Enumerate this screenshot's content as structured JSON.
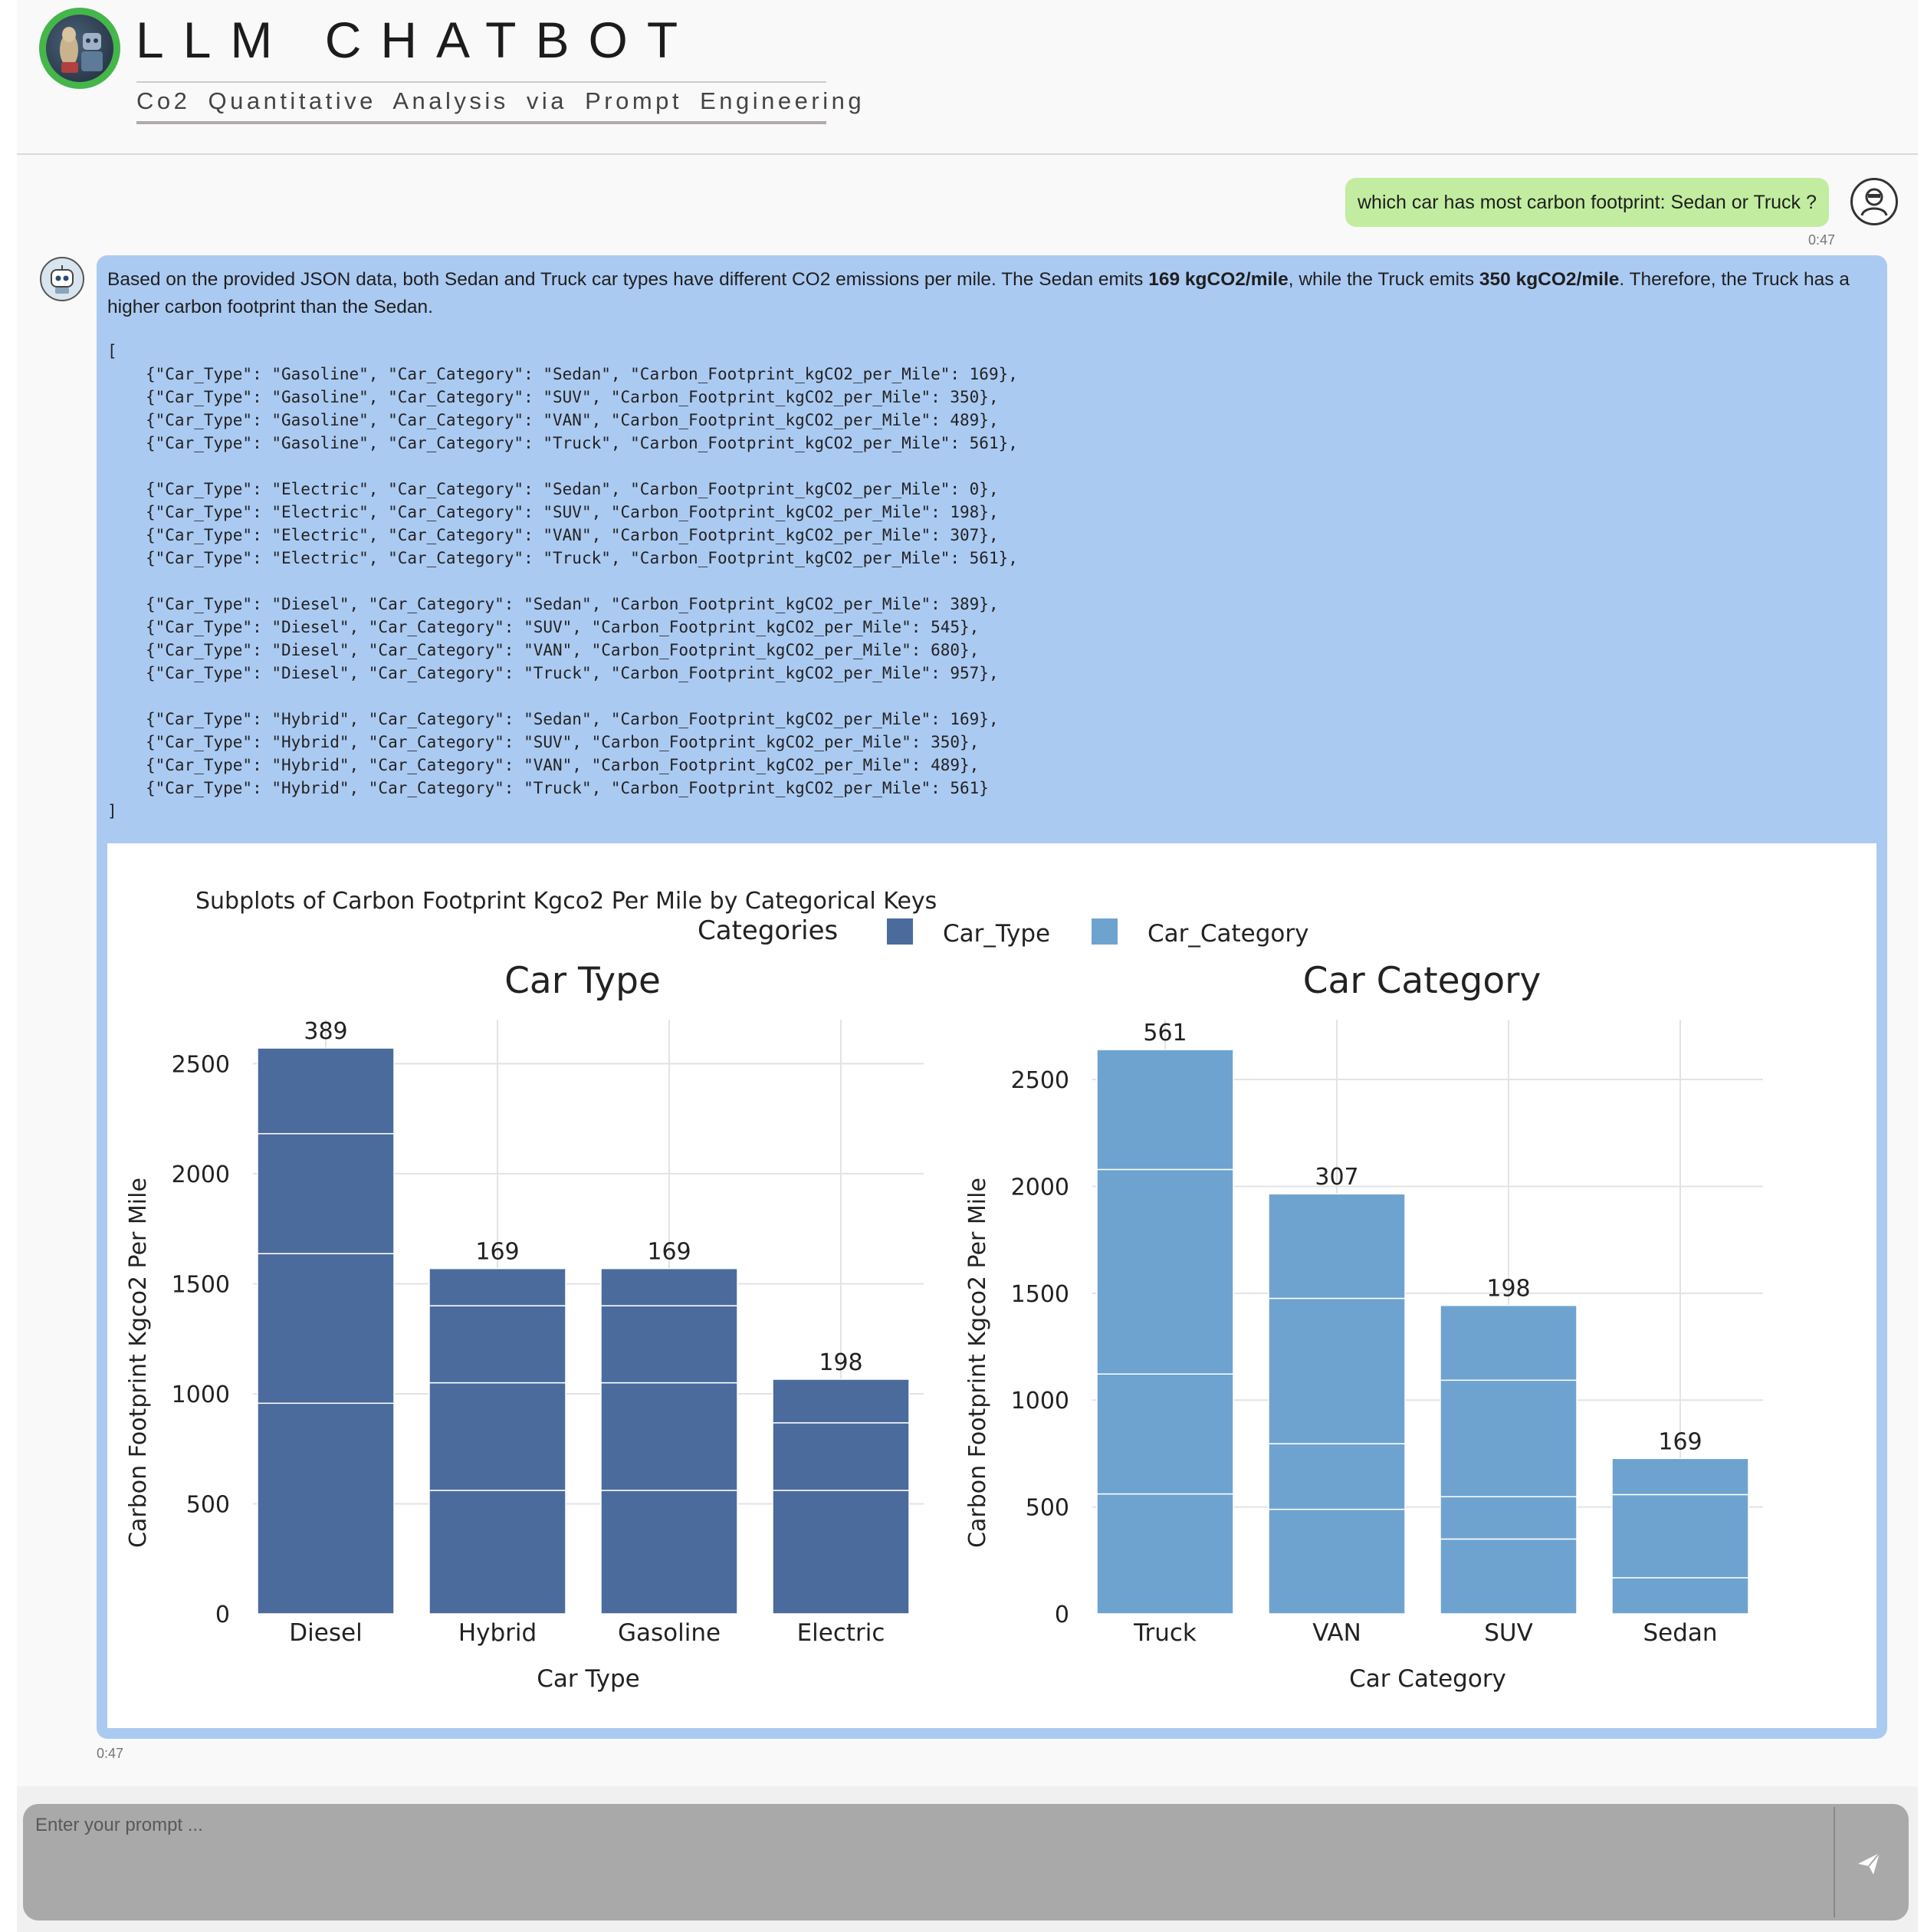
{
  "header": {
    "title": "LLM  CHATBOT",
    "subtitle": "Co2 Quantitative Analysis via Prompt Engineering"
  },
  "icons": {
    "logo": "llama-robot-logo",
    "user_avatar": "user-avatar-icon",
    "bot_avatar": "robot-avatar-icon",
    "send": "send-icon"
  },
  "chat": {
    "user_message": "which car has most carbon footprint: Sedan or Truck ?",
    "user_time": "0:47",
    "bot_text_1": "Based on the provided JSON data, both Sedan and Truck car types have different CO2 emissions per mile. The Sedan emits ",
    "bot_bold_1": "169 kgCO2/mile",
    "bot_text_2": ", while the Truck emits ",
    "bot_bold_2": "350 kgCO2/mile",
    "bot_text_3": ". Therefore, the Truck has a higher carbon footprint than the Sedan.",
    "code_open": "[",
    "code_groups": [
      [
        "{\"Car_Type\": \"Gasoline\", \"Car_Category\": \"Sedan\", \"Carbon_Footprint_kgCO2_per_Mile\": 169},",
        "{\"Car_Type\": \"Gasoline\", \"Car_Category\": \"SUV\", \"Carbon_Footprint_kgCO2_per_Mile\": 350},",
        "{\"Car_Type\": \"Gasoline\", \"Car_Category\": \"VAN\", \"Carbon_Footprint_kgCO2_per_Mile\": 489},",
        "{\"Car_Type\": \"Gasoline\", \"Car_Category\": \"Truck\", \"Carbon_Footprint_kgCO2_per_Mile\": 561},"
      ],
      [
        "{\"Car_Type\": \"Electric\", \"Car_Category\": \"Sedan\", \"Carbon_Footprint_kgCO2_per_Mile\": 0},",
        "{\"Car_Type\": \"Electric\", \"Car_Category\": \"SUV\", \"Carbon_Footprint_kgCO2_per_Mile\": 198},",
        "{\"Car_Type\": \"Electric\", \"Car_Category\": \"VAN\", \"Carbon_Footprint_kgCO2_per_Mile\": 307},",
        "{\"Car_Type\": \"Electric\", \"Car_Category\": \"Truck\", \"Carbon_Footprint_kgCO2_per_Mile\": 561},"
      ],
      [
        "{\"Car_Type\": \"Diesel\", \"Car_Category\": \"Sedan\", \"Carbon_Footprint_kgCO2_per_Mile\": 389},",
        "{\"Car_Type\": \"Diesel\", \"Car_Category\": \"SUV\", \"Carbon_Footprint_kgCO2_per_Mile\": 545},",
        "{\"Car_Type\": \"Diesel\", \"Car_Category\": \"VAN\", \"Carbon_Footprint_kgCO2_per_Mile\": 680},",
        "{\"Car_Type\": \"Diesel\", \"Car_Category\": \"Truck\", \"Carbon_Footprint_kgCO2_per_Mile\": 957},"
      ],
      [
        "{\"Car_Type\": \"Hybrid\", \"Car_Category\": \"Sedan\", \"Carbon_Footprint_kgCO2_per_Mile\": 169},",
        "{\"Car_Type\": \"Hybrid\", \"Car_Category\": \"SUV\", \"Carbon_Footprint_kgCO2_per_Mile\": 350},",
        "{\"Car_Type\": \"Hybrid\", \"Car_Category\": \"VAN\", \"Carbon_Footprint_kgCO2_per_Mile\": 489},",
        "{\"Car_Type\": \"Hybrid\", \"Car_Category\": \"Truck\", \"Carbon_Footprint_kgCO2_per_Mile\": 561}"
      ]
    ],
    "code_close": "]",
    "bot_time": "0:47"
  },
  "input": {
    "placeholder": "Enter your prompt ..."
  },
  "colors": {
    "car_type": "#4b6b9c",
    "car_category": "#6ea3d0",
    "bot_bubble": "#abcaf2",
    "user_bubble": "#c2eda0"
  },
  "chart_data": [
    {
      "type": "bar",
      "stacked": true,
      "title": "Car Type",
      "figure_title": "Subplots of Carbon Footprint Kgco2 Per Mile by Categorical Keys",
      "legend_title": "Categories",
      "legend": [
        "Car_Type",
        "Car_Category"
      ],
      "legend_position": "top-center",
      "series_name": "Car_Type",
      "categories": [
        "Diesel",
        "Hybrid",
        "Gasoline",
        "Electric"
      ],
      "segments": [
        [
          957,
          680,
          545,
          389
        ],
        [
          561,
          489,
          350,
          169
        ],
        [
          561,
          489,
          350,
          169
        ],
        [
          561,
          307,
          198,
          0
        ]
      ],
      "totals": [
        2571,
        1569,
        1569,
        1066
      ],
      "bar_labels": [
        "389",
        "169",
        "169",
        "198"
      ],
      "xlabel": "Car Type",
      "ylabel": "Carbon Footprint Kgco2 Per Mile",
      "yticks": [
        0,
        500,
        1000,
        1500,
        2000,
        2500
      ],
      "ylim": [
        0,
        2700
      ],
      "grid": true
    },
    {
      "type": "bar",
      "stacked": true,
      "title": "Car Category",
      "series_name": "Car_Category",
      "categories": [
        "Truck",
        "VAN",
        "SUV",
        "Sedan"
      ],
      "segments": [
        [
          561,
          561,
          957,
          561
        ],
        [
          489,
          307,
          680,
          489
        ],
        [
          350,
          198,
          545,
          350
        ],
        [
          169,
          0,
          389,
          169
        ]
      ],
      "totals": [
        2640,
        1965,
        1443,
        727
      ],
      "bar_labels": [
        "561",
        "307",
        "198",
        "169"
      ],
      "xlabel": "Car Category",
      "ylabel": "Carbon Footprint Kgco2 Per Mile",
      "yticks": [
        0,
        500,
        1000,
        1500,
        2000,
        2500
      ],
      "ylim": [
        0,
        2780
      ],
      "grid": true
    }
  ]
}
